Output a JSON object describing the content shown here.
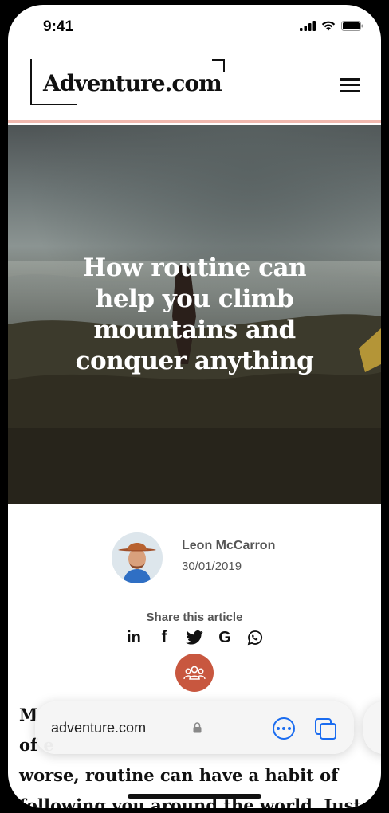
{
  "status_bar": {
    "time": "9:41"
  },
  "header": {
    "logo_text": "Adventure.com"
  },
  "hero": {
    "title": "How routine can help you climb mountains and conquer anything"
  },
  "author": {
    "name": "Leon McCarron",
    "date": "30/01/2019"
  },
  "share": {
    "label": "Share this article",
    "icons": [
      "linkedin-icon",
      "facebook-icon",
      "twitter-icon",
      "google-icon",
      "whatsapp-icon"
    ]
  },
  "article": {
    "lines": [
      "M",
      "of e",
      "worse, routine can have a habit of",
      "following you around the world. Just ask"
    ]
  },
  "browser": {
    "url": "adventure.com"
  },
  "colors": {
    "accent": "#c8573f",
    "header_border": "#f0b8ae",
    "browser_blue": "#1a6cf0"
  }
}
